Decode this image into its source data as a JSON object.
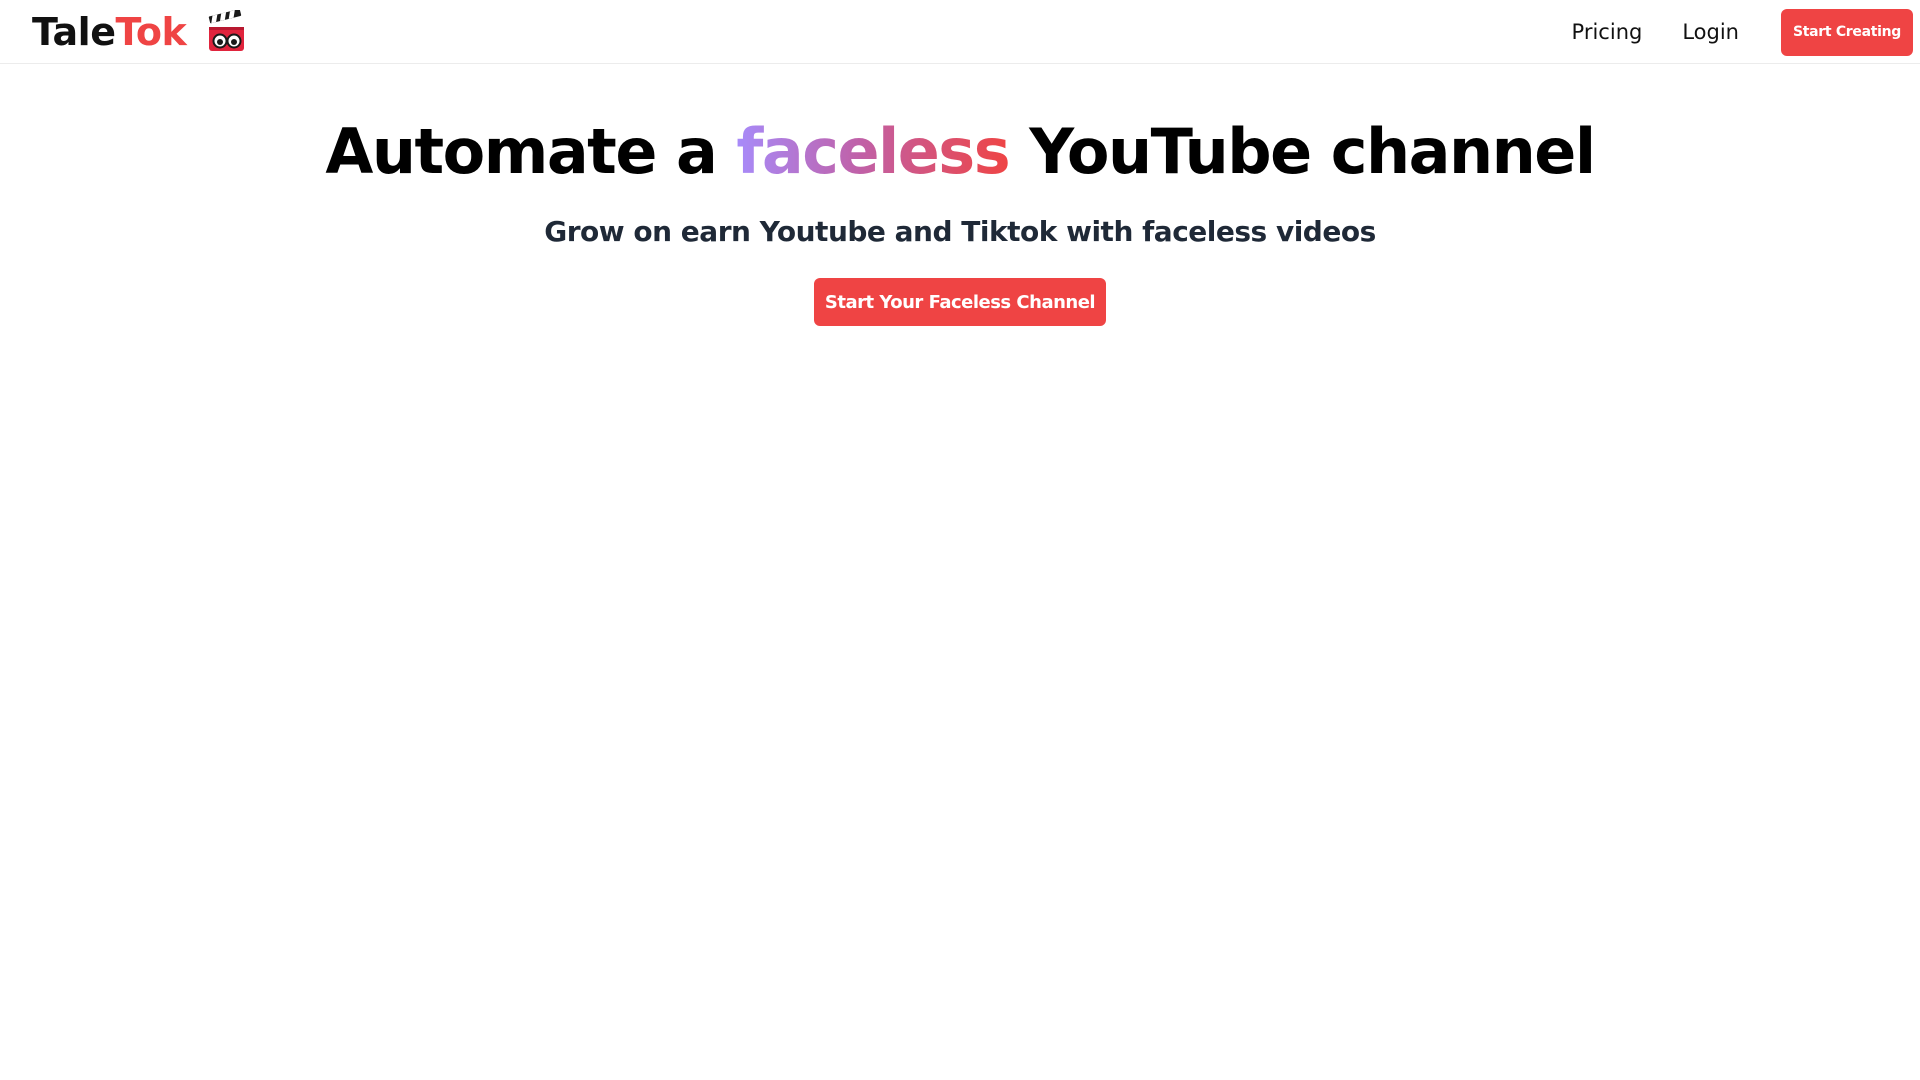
{
  "navbar": {
    "brand": {
      "part1": "Tale",
      "part2": "Tok",
      "logo_icon": "clapperboard-with-eyes-icon"
    },
    "links": {
      "pricing": "Pricing",
      "login": "Login"
    },
    "cta_label": "Start Creating"
  },
  "hero": {
    "title_before": "Automate a ",
    "title_accent": "faceless",
    "title_after": " YouTube channel",
    "subtitle": "Grow on earn Youtube and Tiktok with faceless videos",
    "cta_label": "Start Your Faceless Channel"
  },
  "colors": {
    "brand_red": "#ef4444",
    "accent_gradient_start": "#a78bfa",
    "accent_gradient_end": "#ef4444",
    "subtitle_text": "#1f2937"
  }
}
